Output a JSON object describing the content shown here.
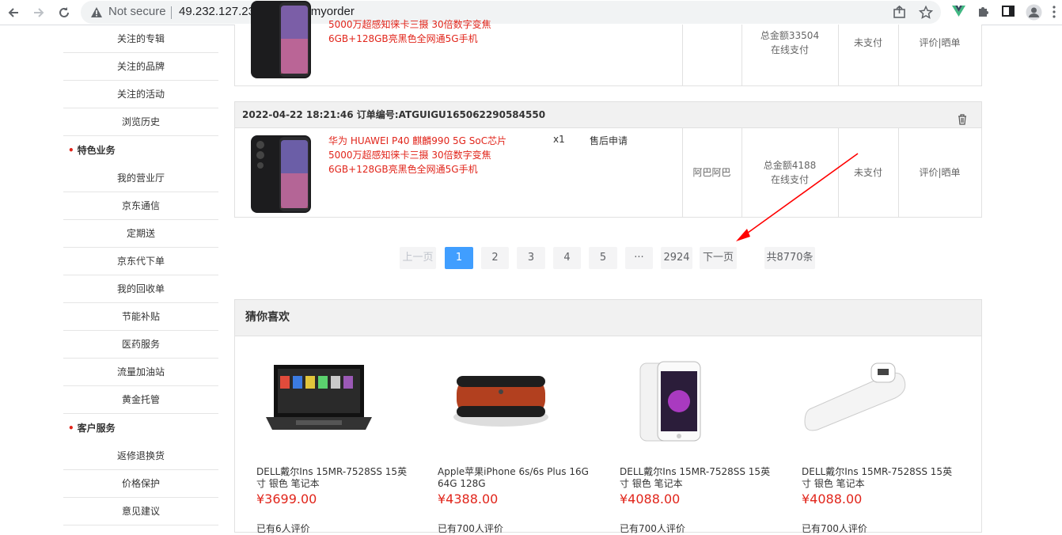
{
  "browser": {
    "not_secure": "Not secure",
    "url": "49.232.127.233/#/center/myorder",
    "icons": [
      "back-arrow-icon",
      "forward-arrow-icon",
      "reload-icon",
      "warning-icon",
      "share-icon",
      "star-icon",
      "vue-devtools-icon",
      "puzzle-icon",
      "side-panel-icon",
      "profile-icon",
      "kebab-menu-icon"
    ]
  },
  "sidebar": {
    "top_items": [
      "关注的专辑",
      "关注的品牌",
      "关注的活动",
      "浏览历史"
    ],
    "section_special": "特色业务",
    "special_items": [
      "我的营业厅",
      "京东通信",
      "定期送",
      "京东代下单",
      "我的回收单",
      "节能补贴",
      "医药服务",
      "流量加油站",
      "黄金托管"
    ],
    "section_service": "客户服务",
    "service_items": [
      "返修退换货",
      "价格保护",
      "意见建议"
    ]
  },
  "order1": {
    "title_line1": "5000万超感知徕卡三摄 30倍数字变焦",
    "title_line2": "6GB+128GB亮黑色全网通5G手机",
    "total": "总金额33504",
    "pay_method": "在线支付",
    "status": "未支付",
    "action": "评价|晒单"
  },
  "order2": {
    "header": "2022-04-22 18:21:46 订单编号:ATGUIGU165062290584550",
    "title_line1": "华为 HUAWEI P40 麒麟990 5G SoC芯片",
    "title_line2": "5000万超感知徕卡三摄 30倍数字变焦",
    "title_line3": "6GB+128GB亮黑色全网通5G手机",
    "qty": "x1",
    "after_sale": "售后申请",
    "consignee": "阿巴阿巴",
    "total": "总金额4188",
    "pay_method": "在线支付",
    "status": "未支付",
    "action": "评价|晒单"
  },
  "pagination": {
    "prev": "上一页",
    "pages": [
      "1",
      "2",
      "3",
      "4",
      "5"
    ],
    "ellipsis": "···",
    "last": "2924",
    "next": "下一页",
    "total": "共8770条",
    "current_page": 1
  },
  "guess": {
    "title": "猜你喜欢",
    "products": [
      {
        "name": "DELL戴尔Ins 15MR-7528SS 15英寸 银色 笔记本",
        "price": "¥3699.00",
        "comments": "已有6人评价"
      },
      {
        "name": "Apple苹果iPhone 6s/6s Plus 16G 64G 128G",
        "price": "¥4388.00",
        "comments": "已有700人评价"
      },
      {
        "name": "DELL戴尔Ins 15MR-7528SS 15英寸 银色 笔记本",
        "price": "¥4088.00",
        "comments": "已有700人评价"
      },
      {
        "name": "DELL戴尔Ins 15MR-7528SS 15英寸 银色 笔记本",
        "price": "¥4088.00",
        "comments": "已有700人评价"
      }
    ]
  },
  "colors": {
    "accent_red": "#e1251b",
    "active_page": "#409eff",
    "annotation_arrow": "#ff0000"
  }
}
